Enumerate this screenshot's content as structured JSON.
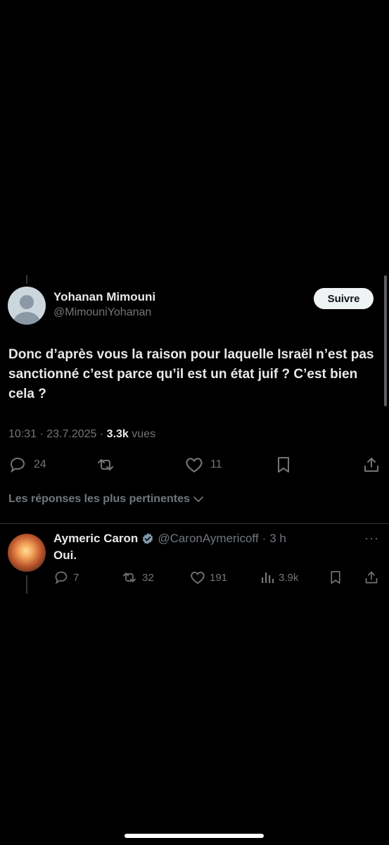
{
  "tweet": {
    "author_name": "Yohanan Mimouni",
    "author_handle": "@MimouniYohanan",
    "follow_label": "Suivre",
    "text": "Donc d’après vous la raison pour laquelle Israël n’est pas sanctionné c’est parce qu’il est un état juif ? C’est bien cela ?",
    "time": "10:31",
    "date": "23.7.2025",
    "views_count": "3.3k",
    "views_label": "vues",
    "replies": "24",
    "likes": "11"
  },
  "sort": {
    "label": "Les réponses les plus pertinentes"
  },
  "reply": {
    "author_name": "Aymeric Caron",
    "author_handle": "@CaronAymericoff",
    "time": "3 h",
    "text": "Oui.",
    "replies": "7",
    "retweets": "32",
    "likes": "191",
    "views": "3.9k",
    "more": "···"
  },
  "colors": {
    "background": "#000000",
    "text": "#e7e9ea",
    "muted": "#71767b",
    "verified": "#829aab"
  },
  "icons": [
    "reply-icon",
    "retweet-icon",
    "like-icon",
    "bookmark-icon",
    "share-icon",
    "views-icon",
    "verified-badge-icon",
    "chevron-down-icon"
  ]
}
